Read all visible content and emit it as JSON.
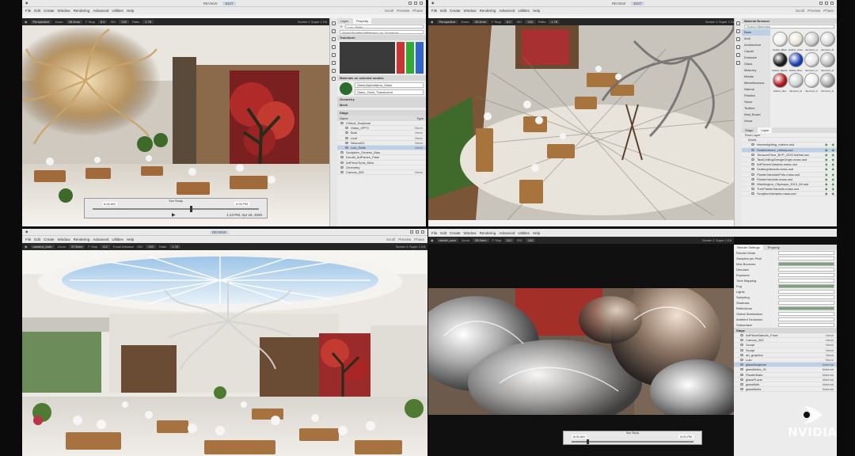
{
  "menus": [
    "File",
    "Edit",
    "Create",
    "Window",
    "Rendering",
    "Advanced",
    "Utilities",
    "Help"
  ],
  "modes": {
    "review": "REVIEW",
    "edit": "EDIT"
  },
  "app_right": [
    "Scroll",
    "Preview",
    "Phase"
  ],
  "viewports": {
    "tl": {
      "camera": "Perspective",
      "focal": "35.0mm",
      "tstop": "8.0",
      "iso": "100",
      "ratio": "1.78",
      "screen": "Screen 1 Super 1 Ed"
    },
    "tr": {
      "camera": "Perspective",
      "focal": "35.0mm",
      "tstop": "8.0",
      "iso": "100",
      "ratio": "1.78",
      "screen": "Screen 1 Super 1 Ed"
    },
    "bl": {
      "camera": "camera_main",
      "focal": "37.8mm",
      "tstop": "6.0",
      "iso": "100",
      "ratio": "1.78",
      "screen": "Screen 1 Super 1 Ed"
    },
    "br": {
      "camera": "render_cam",
      "focal": "35.0mm",
      "tstop": "8.0",
      "iso": "100",
      "ratio": "1.78",
      "screen": "Screen 1 Super 1 Ed"
    }
  },
  "labels": {
    "zoom": "Zoom",
    "tstop": "F Stop",
    "iso": "ISO",
    "ratio": "Ratio",
    "focal": "Focal Distance"
  },
  "property_panel": {
    "tabs": [
      "Layer",
      "Property"
    ],
    "name_value": "Lulu_Stele",
    "path_value": "/World/Seattle/ArtPieces/Lulu_Sculpture",
    "sections": [
      "Transform",
      "Materials on selected models",
      "Geometry",
      "Mesh"
    ],
    "material_value": "Glass/AlphaAlpha_Glass",
    "material_value2": "Glass_Clear_Translucent"
  },
  "stage_tree": {
    "header": "Stage",
    "columns": [
      "Name",
      "Type"
    ],
    "rows": [
      {
        "name": "Chihuli_Sculpture",
        "type": "",
        "sel": false
      },
      {
        "name": "Glass_OPT2",
        "type": "Xform",
        "sel": false
      },
      {
        "name": "Bulb",
        "type": "Mesh",
        "sel": false
      },
      {
        "name": "Leaf",
        "type": "Mesh",
        "sel": false
      },
      {
        "name": "Neuron01",
        "type": "Mesh",
        "sel": false
      },
      {
        "name": "Lulu_Stele",
        "type": "Mesh",
        "sel": true
      },
      {
        "name": "Sculpture_Generic_Man",
        "type": "",
        "sel": false
      },
      {
        "name": "Dorolit_ArtPieces_Flare",
        "type": "",
        "sel": false
      },
      {
        "name": "ArtPieceTools_Mew",
        "type": "",
        "sel": false
      },
      {
        "name": "Geometry",
        "type": "",
        "sel": false
      },
      {
        "name": "Canvas_003",
        "type": "Mesh",
        "sel": false
      }
    ]
  },
  "timeline_tl": {
    "title": "Sun Study",
    "start": "6:00 AM",
    "end": "6:00 PM",
    "current": "1:13 PM, Apr 16, 2020",
    "position": 0.58
  },
  "timeline_br": {
    "title": "Sun Study",
    "start": "6:00 AM",
    "end": "6:00 PM",
    "position": 0.12
  },
  "material_browser": {
    "title": "Material Browser",
    "search_placeholder": "Search Materials",
    "categories": [
      "Base",
      "Arch",
      "Architecture",
      "Carpet",
      "Emissive",
      "Glass",
      "Masonry",
      "Metals",
      "Miscellaneous",
      "Natural",
      "Plastics",
      "Stone",
      "Textiles",
      "Wall_Board",
      "Wood"
    ],
    "swatches": [
      {
        "name": "Rubber_Black",
        "color": "#f0efe8"
      },
      {
        "name": "Rubber_Violet",
        "color": "#e7e3d6"
      },
      {
        "name": "Aluminum_A",
        "color": "#cfcfcf"
      },
      {
        "name": "Aluminum_B",
        "color": "#d9d9d9"
      },
      {
        "name": "Rubber_Black2",
        "color": "#1a1a1a"
      },
      {
        "name": "Rubber_Blue",
        "color": "#1d3fb5"
      },
      {
        "name": "Aluminum_C",
        "color": "#e6e6e6"
      },
      {
        "name": "Aluminum_D",
        "color": "#bdbdbd"
      },
      {
        "name": "Rubber_Red",
        "color": "#b31818"
      },
      {
        "name": "Aluminum_E",
        "color": "#d2d2d2"
      },
      {
        "name": "Aluminum_F",
        "color": "#ededed"
      },
      {
        "name": "Aluminum_G",
        "color": "#a9a9a9"
      }
    ]
  },
  "layer_panel": {
    "tabs": [
      "Stage",
      "Layer"
    ],
    "root": "Root Layer",
    "world": "World",
    "rows": [
      "Interiorlighting_Interior.usd",
      "ScaleArtwork_chihuly.usd",
      "TerrazzoFloor_BYP_2020.livelink.usd",
      "TadsCeiling/DesignOrigin.mass.usd",
      "ArtPieces/Variants.mass.usd",
      "SeatingVariants.mass.usd",
      "PlanterVariants/Pots.mass.usd",
      "PlanterVariants.mass.usd",
      "Washington_Citymaps_2019_56.usd",
      "TreePlanterVariants.mass.usd",
      "SculptureVariants.mass.usd"
    ]
  },
  "br_panel": {
    "tabs": [
      "Render Settings",
      "Property"
    ],
    "rows": [
      "Render Mode",
      "Samples per Pixel",
      "Max Bounces",
      "Denoiser",
      "Exposure",
      "Tone Mapping",
      "Fog",
      "Lights",
      "Sampling",
      "Shadows",
      "Reflections",
      "Global Illumination",
      "Ambient Occlusion",
      "Subsurface"
    ],
    "stage_rows": [
      {
        "name": "ArtPieceStandIn_Front",
        "type": "Mesh"
      },
      {
        "name": "Canvas_003",
        "type": "Mesh"
      },
      {
        "name": "Sculpt",
        "type": "Mesh"
      },
      {
        "name": "Sculpt",
        "type": "Mesh"
      },
      {
        "name": "art_graphics",
        "type": "Mesh"
      },
      {
        "name": "Lulu",
        "type": "Xform"
      },
      {
        "name": "glassSculpture",
        "type": "Material"
      },
      {
        "name": "glassBulbs_01",
        "type": "Material"
      },
      {
        "name": "PlanterMats",
        "type": "Material"
      },
      {
        "name": "glassPLane",
        "type": "Material"
      },
      {
        "name": "glassBulb",
        "type": "Material"
      },
      {
        "name": "glassBulbs",
        "type": "Material"
      }
    ]
  },
  "brand": {
    "name": "NVIDIA"
  }
}
